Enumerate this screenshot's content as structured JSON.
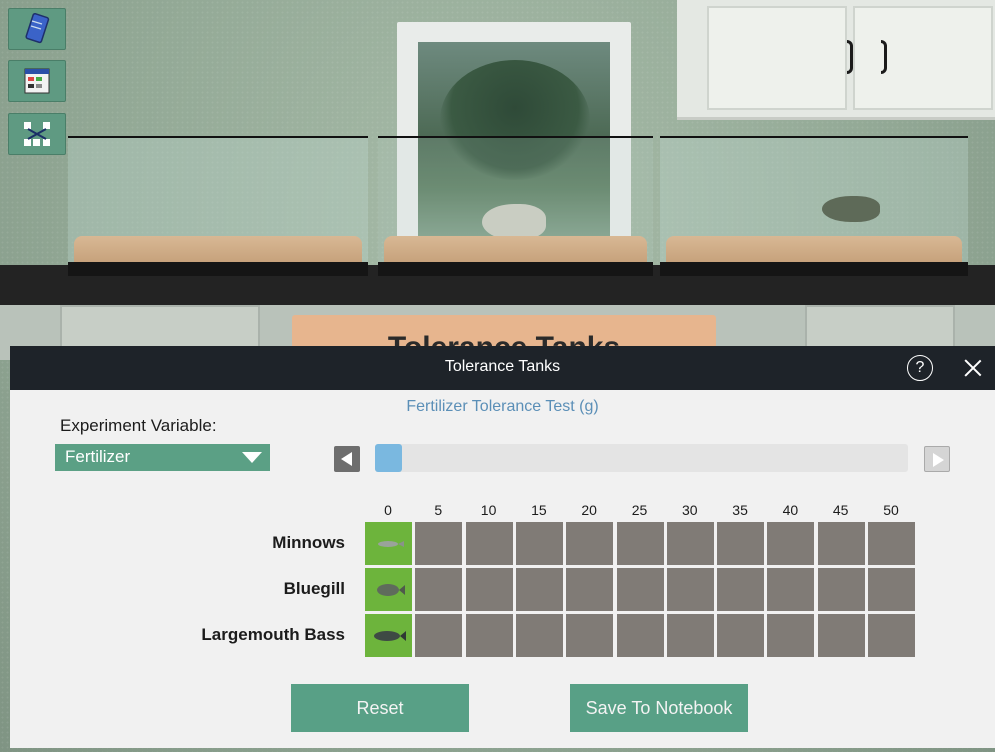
{
  "modal": {
    "title": "Tolerance Tanks",
    "help_glyph": "?",
    "subtitle": "Fertilizer Tolerance Test (g)",
    "experiment_label": "Experiment Variable:",
    "experiment_value": "Fertilizer",
    "slider_progress": 0.05
  },
  "background_sign": "Tolerance Tanks",
  "grid": {
    "columns": [
      "0",
      "5",
      "10",
      "15",
      "20",
      "25",
      "30",
      "35",
      "40",
      "45",
      "50"
    ],
    "rows": [
      {
        "label": "Minnows",
        "alive_columns": [
          "0"
        ]
      },
      {
        "label": "Bluegill",
        "alive_columns": [
          "0"
        ]
      },
      {
        "label": "Largemouth Bass",
        "alive_columns": [
          "0"
        ]
      }
    ]
  },
  "buttons": {
    "reset": "Reset",
    "save": "Save To Notebook"
  },
  "toolbar": [
    {
      "icon": "notebook-icon"
    },
    {
      "icon": "data-table-icon"
    },
    {
      "icon": "food-web-icon"
    }
  ],
  "colors": {
    "header_bg": "#1e2329",
    "accent_green": "#58a086",
    "alive_cell": "#6db43c",
    "dead_cell": "#807b76",
    "subtitle_blue": "#5b8fb7",
    "slider_fill": "#7ab8e0"
  }
}
